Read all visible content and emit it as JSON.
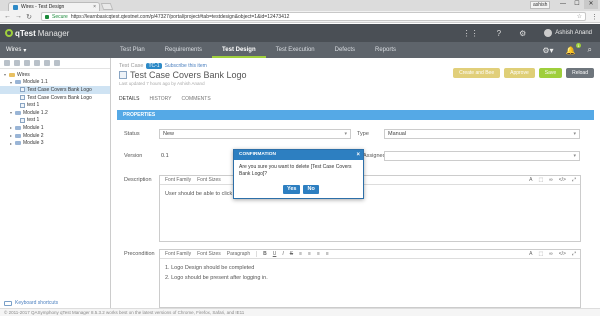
{
  "browser": {
    "tab_title": "Wires - Test Design",
    "tab_close": "×",
    "profile": "ashish",
    "window_buttons": [
      "—",
      "☐",
      "✕"
    ],
    "secure_label": "Secure",
    "url": "https://learnbasicqtest.qtestnet.com/p/47327/portal/project#tab=testdesign&object=1&id=12473412"
  },
  "app": {
    "logo_primary": "qTest",
    "logo_secondary": "Manager",
    "user_name": "Ashish Anand",
    "project": "Wires",
    "nav_tabs": [
      "Test Plan",
      "Requirements",
      "Test Design",
      "Test Execution",
      "Defects",
      "Reports"
    ],
    "active_tab": "Test Design",
    "bell_count": "1"
  },
  "tree": {
    "items": [
      {
        "label": "Wires",
        "kind": "root"
      },
      {
        "label": "Module 1.1",
        "kind": "module"
      },
      {
        "label": "Test Case Covers Bank Logo",
        "kind": "tc",
        "selected": true
      },
      {
        "label": "Test Case Covers Bank Logo",
        "kind": "tc"
      },
      {
        "label": "test 1",
        "kind": "tc"
      },
      {
        "label": "Module 1.2",
        "kind": "module"
      },
      {
        "label": "test 1",
        "kind": "tc"
      },
      {
        "label": "Module 1",
        "kind": "module"
      },
      {
        "label": "Module 2",
        "kind": "module"
      },
      {
        "label": "Module 3",
        "kind": "module"
      }
    ],
    "keyboard_shortcuts": "Keyboard shortcuts"
  },
  "testcase": {
    "crumb_prefix": "Test Case",
    "id": "TC-1",
    "subscribe": "Subscribe this item",
    "title": "Test Case Covers Bank Logo",
    "updated": "Last updated 7 hours ago by Ashish Anand",
    "actions": [
      "Create and Bee",
      "Approve",
      "Save",
      "Reload"
    ],
    "subtabs": [
      "DETAILS",
      "HISTORY",
      "COMMENTS"
    ]
  },
  "properties": {
    "header": "PROPERTIES",
    "status_label": "Status",
    "status_value": "New",
    "type_label": "Type",
    "type_value": "Manual",
    "version_label": "Version",
    "version_value": "0.1",
    "assigned_label": "Assigned",
    "description_label": "Description",
    "description_text": "User should be able to click on logo and it should navigate to home page.",
    "precondition_label": "Precondition",
    "precondition_lines": [
      "1. Logo Design should be completed",
      "2. Logo should be present after logging in."
    ],
    "toolbar": [
      "Font Family",
      "Font Sizes",
      "Paragraph",
      "B",
      "U",
      "I",
      "S",
      "≡",
      "≡",
      "≡",
      "≡",
      "A",
      "⬚",
      "∞",
      "</>",
      "⤢"
    ]
  },
  "dialog": {
    "title": "CONFIRMATION",
    "message": "Are you sure you want to delete [Test Case Covers Bank Logo]?",
    "yes": "Yes",
    "no": "No",
    "close": "×"
  },
  "footer": {
    "text": "© 2011-2017 QASymphony  qTest Manager 8.5.3.2 works best on the latest versions of Chrome, Firefox, Safari, and IE11"
  }
}
